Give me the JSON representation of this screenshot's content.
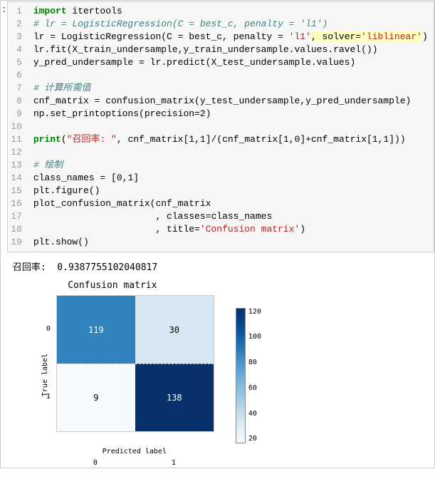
{
  "code": {
    "lines": [
      {
        "n": "1",
        "seg": [
          {
            "t": "import",
            "c": "kw"
          },
          {
            "t": " itertools"
          }
        ]
      },
      {
        "n": "2",
        "seg": [
          {
            "t": "# lr = LogisticRegression(C = best_c, penalty = 'l1')",
            "c": "comment"
          }
        ]
      },
      {
        "n": "3",
        "seg": [
          {
            "t": "lr = LogisticRegression(C = best_c, penalty = "
          },
          {
            "t": "'l1'",
            "c": "str"
          },
          {
            "t": ", solver=",
            "c": "highlight"
          },
          {
            "t": "'liblinear'",
            "c": "str highlight"
          },
          {
            "t": ")"
          }
        ]
      },
      {
        "n": "4",
        "seg": [
          {
            "t": "lr.fit(X_train_undersample,y_train_undersample.values.ravel())"
          }
        ]
      },
      {
        "n": "5",
        "seg": [
          {
            "t": "y_pred_undersample = lr.predict(X_test_undersample.values)"
          }
        ]
      },
      {
        "n": "6",
        "seg": []
      },
      {
        "n": "7",
        "seg": [
          {
            "t": "# 计算所需值",
            "c": "comment"
          }
        ]
      },
      {
        "n": "8",
        "seg": [
          {
            "t": "cnf_matrix = confusion_matrix(y_test_undersample,y_pred_undersample)"
          }
        ]
      },
      {
        "n": "9",
        "seg": [
          {
            "t": "np.set_printoptions(precision="
          },
          {
            "t": "2"
          },
          {
            "t": ")"
          }
        ]
      },
      {
        "n": "10",
        "seg": []
      },
      {
        "n": "11",
        "seg": [
          {
            "t": "print",
            "c": "kw"
          },
          {
            "t": "("
          },
          {
            "t": "\"召回率: \"",
            "c": "str"
          },
          {
            "t": ", cnf_matrix["
          },
          {
            "t": "1"
          },
          {
            "t": ","
          },
          {
            "t": "1"
          },
          {
            "t": "]/(cnf_matrix["
          },
          {
            "t": "1"
          },
          {
            "t": ","
          },
          {
            "t": "0"
          },
          {
            "t": "]+cnf_matrix["
          },
          {
            "t": "1"
          },
          {
            "t": ","
          },
          {
            "t": "1"
          },
          {
            "t": "]))"
          }
        ]
      },
      {
        "n": "12",
        "seg": []
      },
      {
        "n": "13",
        "seg": [
          {
            "t": "# 绘制",
            "c": "comment"
          }
        ]
      },
      {
        "n": "14",
        "seg": [
          {
            "t": "class_names = ["
          },
          {
            "t": "0"
          },
          {
            "t": ","
          },
          {
            "t": "1"
          },
          {
            "t": "]"
          }
        ]
      },
      {
        "n": "15",
        "seg": [
          {
            "t": "plt.figure()"
          }
        ]
      },
      {
        "n": "16",
        "seg": [
          {
            "t": "plot_confusion_matrix(cnf_matrix"
          }
        ]
      },
      {
        "n": "17",
        "seg": [
          {
            "t": "                      , classes=class_names"
          }
        ]
      },
      {
        "n": "18",
        "seg": [
          {
            "t": "                      , title="
          },
          {
            "t": "'Confusion matrix'",
            "c": "str"
          },
          {
            "t": ")"
          }
        ]
      },
      {
        "n": "19",
        "seg": [
          {
            "t": "plt.show()"
          }
        ]
      }
    ]
  },
  "output": {
    "recall_label": "召回率:",
    "recall_value": "0.9387755102040817"
  },
  "chart_data": {
    "type": "heatmap",
    "title": "Confusion matrix",
    "xlabel": "Predicted label",
    "ylabel": "True label",
    "x_categories": [
      "0",
      "1"
    ],
    "y_categories": [
      "0",
      "1"
    ],
    "values": [
      [
        119,
        30
      ],
      [
        9,
        138
      ]
    ],
    "colorbar_ticks": [
      "120",
      "100",
      "80",
      "60",
      "40",
      "20"
    ],
    "colorbar_range": [
      0,
      138
    ]
  },
  "prompt_indicator": ":"
}
